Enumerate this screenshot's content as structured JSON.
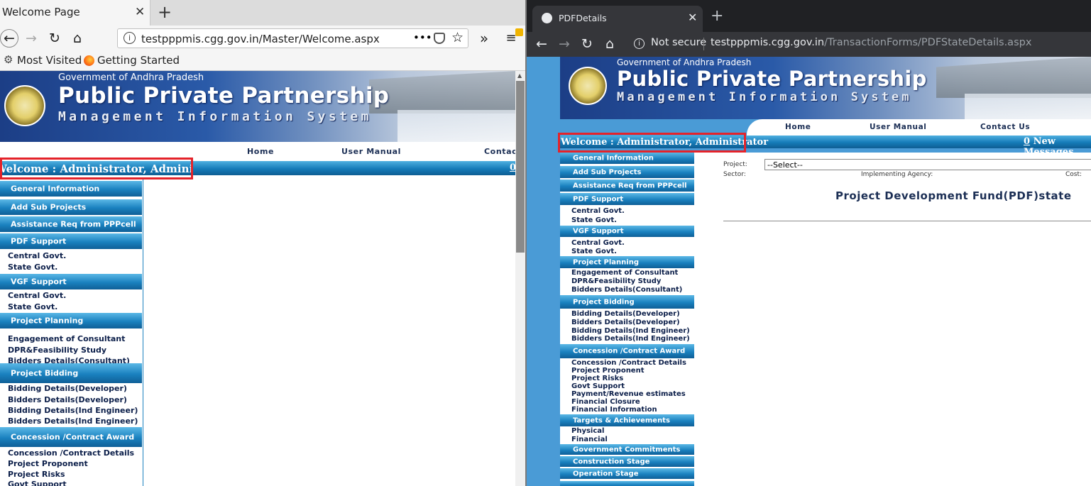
{
  "left_browser": {
    "tab_title": "Welcome Page",
    "url": "testpppmis.cgg.gov.in/Master/Welcome.aspx",
    "bookmarks": [
      "Most Visited",
      "Getting Started"
    ],
    "icons": [
      "back-icon",
      "forward-icon",
      "reload-icon",
      "home-icon",
      "info-icon",
      "more-icon",
      "pocket-icon",
      "star-icon",
      "overflow-icon",
      "menu-icon",
      "gear-icon",
      "firefox-icon"
    ]
  },
  "right_browser": {
    "tab_title": "PDFDetails",
    "security_label": "Not secure",
    "url_host": "testpppmis.cgg.gov.in",
    "url_path": "/TransactionForms/PDFStateDetails.aspx",
    "icons": [
      "globe-icon",
      "back-icon",
      "forward-icon",
      "reload-icon",
      "home-icon",
      "info-icon"
    ]
  },
  "site": {
    "gov": "Government of Andhra Pradesh",
    "title": "Public Private Partnership",
    "subtitle": "Management Information System",
    "nav": [
      "Home",
      "User Manual",
      "Contact Us"
    ],
    "nav_left_contact": "Contact",
    "welcome_left": "Welcome : Administrator, Administrator",
    "welcome_right": "Welcome : Administrator, Administrator",
    "msg_count": "0",
    "msg_label": "New Messages"
  },
  "left_menu": {
    "general": "General Information",
    "add_sub": "Add Sub Projects",
    "assist": "Assistance Req from PPPcell",
    "pdf": "PDF Support",
    "pdf_items": [
      "Central Govt.",
      "State Govt."
    ],
    "vgf": "VGF Support",
    "vgf_items": [
      "Central Govt.",
      "State Govt."
    ],
    "planning": "Project Planning",
    "planning_items": [
      "Engagement of Consultant",
      "DPR&Feasibility Study",
      "Bidders Details(Consultant)"
    ],
    "bidding": "Project Bidding",
    "bidding_items": [
      "Bidding Details(Developer)",
      "Bidders Details(Developer)",
      "Bidding Details(Ind Engineer)",
      "Bidders Details(Ind Engineer)"
    ],
    "concession": "Concession /Contract Award",
    "concession_items": [
      "Concession /Contract Details",
      "Project Proponent",
      "Project Risks",
      "Govt Support"
    ]
  },
  "right_menu": {
    "general": "General Information",
    "add_sub": "Add Sub Projects",
    "assist": "Assistance Req from PPPcell",
    "pdf": "PDF Support",
    "pdf_items": [
      "Central Govt.",
      "State Govt."
    ],
    "vgf": "VGF Support",
    "vgf_items": [
      "Central Govt.",
      "State Govt."
    ],
    "planning": "Project Planning",
    "planning_items": [
      "Engagement of Consultant",
      "DPR&Feasibility Study",
      "Bidders Details(Consultant)"
    ],
    "bidding": "Project Bidding",
    "bidding_items": [
      "Bidding Details(Developer)",
      "Bidders Details(Developer)",
      "Bidding Details(Ind Engineer)",
      "Bidders Details(Ind Engineer)"
    ],
    "concession": "Concession /Contract Award",
    "concession_items": [
      "Concession /Contract Details",
      "Project Proponent",
      "Project Risks",
      "Govt Support",
      "Payment/Revenue estimates",
      "Financial Closure",
      "Financial Information"
    ],
    "targets": "Targets & Achievements",
    "targets_items": [
      "Physical",
      "Financial"
    ],
    "commitments": "Government Commitments",
    "construction": "Construction Stage",
    "operation": "Operation Stage"
  },
  "form": {
    "project_label": "Project:",
    "project_value": "--Select--",
    "sector_label": "Sector:",
    "agency_label": "Implementing Agency:",
    "cost_label": "Cost:",
    "heading": "Project Development Fund(PDF)state"
  },
  "colors": {
    "highlight_box": "#e4232a",
    "menu_blue": "#1a81bf",
    "heading_navy": "#1c2f55"
  }
}
